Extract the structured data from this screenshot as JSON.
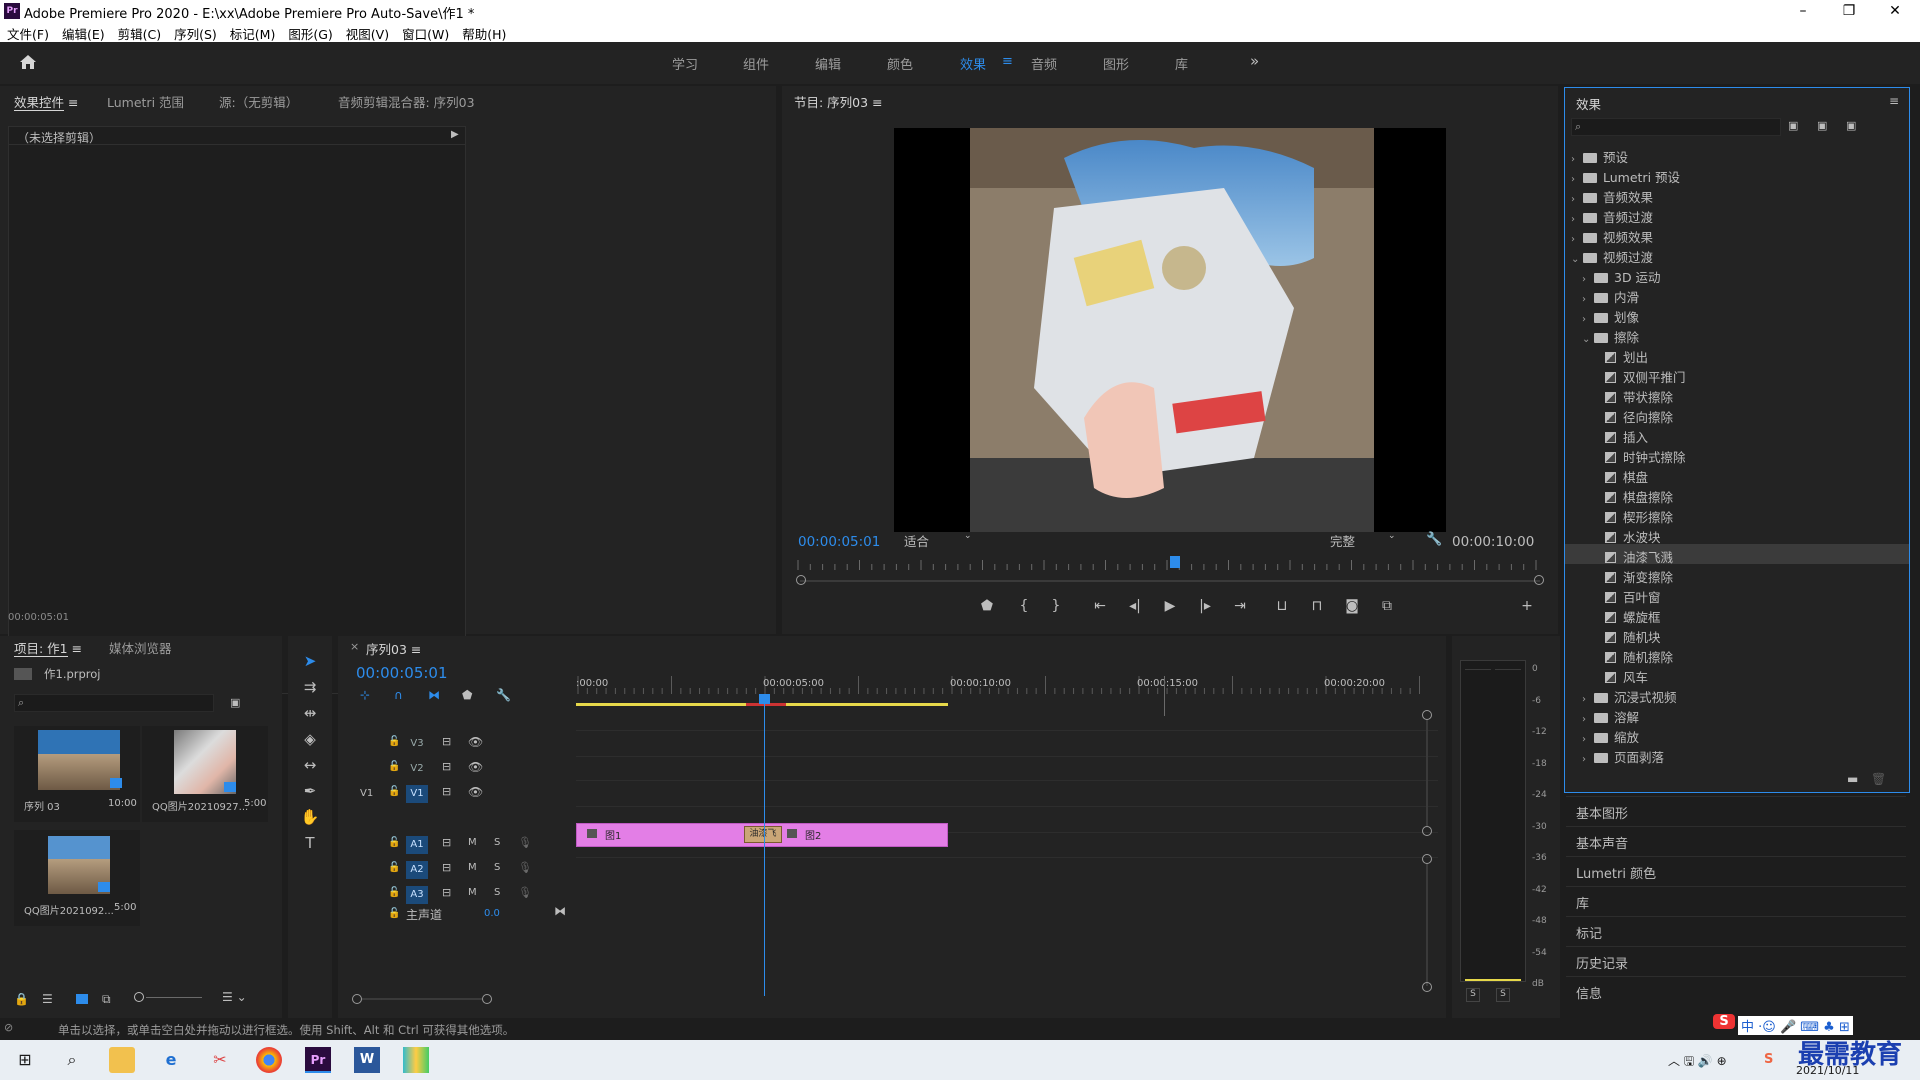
{
  "window": {
    "title": "Adobe Premiere Pro 2020 - E:\\xx\\Adobe Premiere Pro Auto-Save\\作1 *",
    "icon_label": "Pr",
    "controls": [
      "–",
      "❐",
      "✕"
    ]
  },
  "menu": [
    "文件(F)",
    "编辑(E)",
    "剪辑(C)",
    "序列(S)",
    "标记(M)",
    "图形(G)",
    "视图(V)",
    "窗口(W)",
    "帮助(H)"
  ],
  "workspaces": {
    "tabs": [
      "学习",
      "组件",
      "编辑",
      "颜色",
      "效果",
      "音频",
      "图形",
      "库"
    ],
    "active": "效果",
    "more": "»"
  },
  "effect_controls": {
    "tabs": [
      "效果控件",
      "Lumetri 范围",
      "源:（无剪辑）",
      "音频剪辑混合器: 序列03"
    ],
    "no_clip": "（未选择剪辑）",
    "timecode": "00:00:05:01"
  },
  "program_monitor": {
    "title": "节目: 序列03",
    "timecode": "00:00:05:01",
    "fit": "适合",
    "quality": "完整",
    "duration": "00:00:10:00",
    "playhead_fraction": 0.5
  },
  "effects_panel": {
    "title": "效果",
    "search_placeholder": "",
    "tree": [
      {
        "label": "预设",
        "level": 0,
        "type": "folder-special",
        "expanded": false
      },
      {
        "label": "Lumetri 预设",
        "level": 0,
        "type": "folder-special",
        "expanded": false
      },
      {
        "label": "音频效果",
        "level": 0,
        "type": "folder",
        "expanded": false
      },
      {
        "label": "音频过渡",
        "level": 0,
        "type": "folder",
        "expanded": false
      },
      {
        "label": "视频效果",
        "level": 0,
        "type": "folder",
        "expanded": false
      },
      {
        "label": "视频过渡",
        "level": 0,
        "type": "folder",
        "expanded": true
      },
      {
        "label": "3D 运动",
        "level": 1,
        "type": "folder",
        "expanded": false
      },
      {
        "label": "内滑",
        "level": 1,
        "type": "folder",
        "expanded": false
      },
      {
        "label": "划像",
        "level": 1,
        "type": "folder",
        "expanded": false
      },
      {
        "label": "擦除",
        "level": 1,
        "type": "folder",
        "expanded": true
      },
      {
        "label": "划出",
        "level": 2,
        "type": "effect"
      },
      {
        "label": "双侧平推门",
        "level": 2,
        "type": "effect"
      },
      {
        "label": "带状擦除",
        "level": 2,
        "type": "effect"
      },
      {
        "label": "径向擦除",
        "level": 2,
        "type": "effect"
      },
      {
        "label": "插入",
        "level": 2,
        "type": "effect"
      },
      {
        "label": "时钟式擦除",
        "level": 2,
        "type": "effect"
      },
      {
        "label": "棋盘",
        "level": 2,
        "type": "effect"
      },
      {
        "label": "棋盘擦除",
        "level": 2,
        "type": "effect"
      },
      {
        "label": "楔形擦除",
        "level": 2,
        "type": "effect"
      },
      {
        "label": "水波块",
        "level": 2,
        "type": "effect"
      },
      {
        "label": "油漆飞溅",
        "level": 2,
        "type": "effect",
        "selected": true
      },
      {
        "label": "渐变擦除",
        "level": 2,
        "type": "effect"
      },
      {
        "label": "百叶窗",
        "level": 2,
        "type": "effect"
      },
      {
        "label": "螺旋框",
        "level": 2,
        "type": "effect"
      },
      {
        "label": "随机块",
        "level": 2,
        "type": "effect"
      },
      {
        "label": "随机擦除",
        "level": 2,
        "type": "effect"
      },
      {
        "label": "风车",
        "level": 2,
        "type": "effect"
      },
      {
        "label": "沉浸式视频",
        "level": 1,
        "type": "folder",
        "expanded": false
      },
      {
        "label": "溶解",
        "level": 1,
        "type": "folder",
        "expanded": false
      },
      {
        "label": "缩放",
        "level": 1,
        "type": "folder",
        "expanded": false
      },
      {
        "label": "页面剥落",
        "level": 1,
        "type": "folder",
        "expanded": false
      }
    ]
  },
  "side_panels": [
    "基本图形",
    "基本声音",
    "Lumetri 颜色",
    "库",
    "标记",
    "历史记录",
    "信息"
  ],
  "project": {
    "tabs": [
      "项目: 作1",
      "媒体浏览器"
    ],
    "file": "作1.prproj",
    "items": [
      {
        "name": "序列 03",
        "duration": "10:00"
      },
      {
        "name": "QQ图片20210927...",
        "duration": "5:00"
      },
      {
        "name": "QQ图片2021092...",
        "duration": "5:00"
      }
    ]
  },
  "timeline": {
    "tab": "序列03",
    "timecode": "00:00:05:01",
    "ruler": [
      ":00:00",
      "00:00:05:00",
      "00:00:10:00",
      "00:00:15:00",
      "00:00:20:00"
    ],
    "video_tracks": [
      "V3",
      "V2",
      "V1"
    ],
    "audio_tracks": [
      "A1",
      "A2",
      "A3"
    ],
    "source_patch": "V1",
    "master": {
      "label": "主声道",
      "value": "0.0"
    },
    "clips": [
      {
        "label": "图1",
        "track": "V1"
      },
      {
        "label": "图2",
        "track": "V1"
      }
    ],
    "transition_label": "油漆飞",
    "mute_label": "M",
    "solo_label": "S"
  },
  "meter": {
    "scale": [
      "0",
      "-6",
      "-12",
      "-18",
      "-24",
      "-30",
      "-36",
      "-42",
      "-48",
      "-54",
      "dB"
    ],
    "solo": [
      "S",
      "S"
    ]
  },
  "status_bar": {
    "text": "单击以选择，或单击空白处并拖动以进行框选。使用 Shift、Alt 和 Ctrl 可获得其他选项。"
  },
  "taskbar": {
    "date": "2021/10/11",
    "watermark": "最需教育",
    "ime": "中"
  },
  "colors": {
    "accent": "#2d8ceb",
    "clip": "#e37ee6",
    "panel": "#232323",
    "background": "#1d1d1d"
  }
}
